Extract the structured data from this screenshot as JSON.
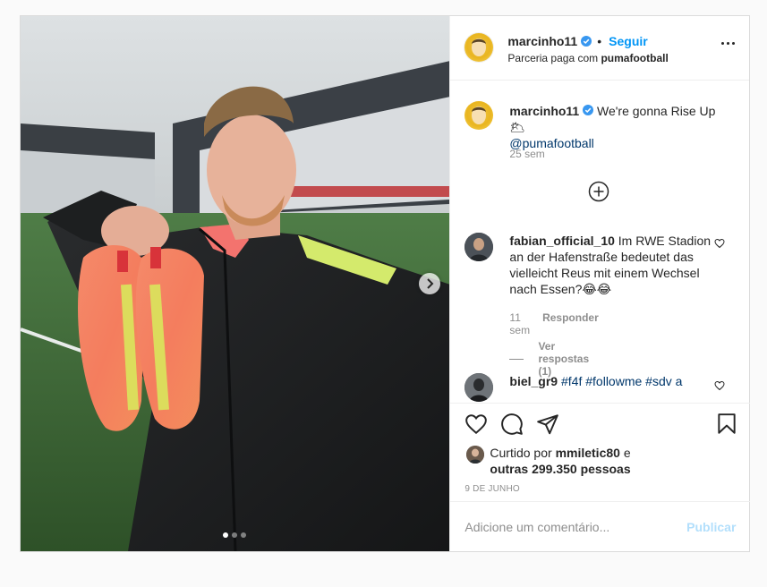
{
  "header": {
    "username": "marcinho11",
    "separator": "•",
    "follow_label": "Seguir",
    "partnership_prefix": "Parceria paga com",
    "partner_name": "pumafootball",
    "more_icon": "more-horizontal-icon"
  },
  "caption": {
    "username": "marcinho11",
    "text": "We're gonna Rise Up 🌥",
    "mention": "@pumafootball",
    "time": "25 sem"
  },
  "load_more_icon": "plus-circle-icon",
  "comments": [
    {
      "username": "fabian_official_10",
      "text": "Im RWE Stadion an der Hafenstraße bedeutet das vielleicht Reus mit einem Wechsel nach Essen?😂😂",
      "time": "11 sem",
      "reply_label": "Responder",
      "view_replies": "Ver respostas (1)"
    },
    {
      "username": "biel_gr9",
      "text": "#f4f #followme #sdv a"
    }
  ],
  "likes": {
    "prefix": "Curtido por",
    "user": "mmiletic80",
    "suffix": "e",
    "others": "outras 299.350 pessoas"
  },
  "date": "9 de junho",
  "add_comment": {
    "placeholder": "Adicione um comentário...",
    "publish_label": "Publicar"
  },
  "carousel": {
    "current": 1,
    "total": 3
  },
  "colors": {
    "accent_blue": "#0095f6",
    "publish_disabled": "#b2dffc",
    "muted_text": "#8e8e8e",
    "mention": "#00376b",
    "border": "#dbdbdb"
  }
}
